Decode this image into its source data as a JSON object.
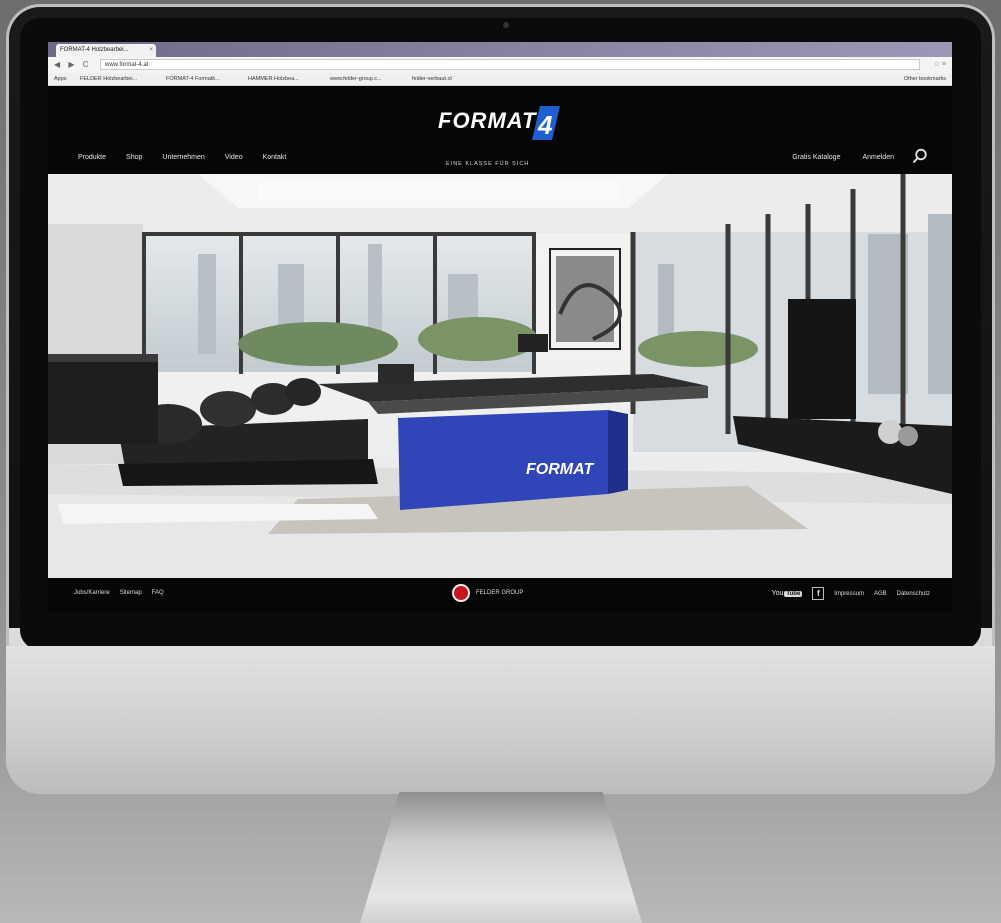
{
  "browser": {
    "tab_title": "FORMAT-4 Holzbearbei...",
    "tab_close": "×",
    "nav_buttons": "◀ ▶ C",
    "url": "www.format-4.at",
    "addr_icons": "☆ ≡",
    "bookmarks": [
      "Apps",
      "FELDER Holzbearbei...",
      "FORMAT-4 Formatk...",
      "HAMMER Holzbea...",
      "www.felder-group.c...",
      "felder-verbaut.ol"
    ],
    "other_bookmarks": "Other bookmarks"
  },
  "header": {
    "logo_text": "FORMAT",
    "logo_number": "4",
    "tagline": "EINE KLASSE FÜR SICH",
    "main_nav": [
      "Produkte",
      "Shop",
      "Unternehmen",
      "Video",
      "Kontakt"
    ],
    "right_nav": [
      "Gratis Kataloge",
      "Anmelden"
    ],
    "brand_color": "#1f5fd1"
  },
  "footer": {
    "left_links": [
      "Jobs/Karriere",
      "Sitemap",
      "FAQ"
    ],
    "felder_text": "FELDER GROUP",
    "youtube": "You",
    "youtube_tube": "Tube",
    "facebook": "f",
    "right_links": [
      "Impressum",
      "AGB",
      "Datenschutz"
    ]
  },
  "hero": {
    "machine_label": "FORMAT",
    "machine_color": "#2f45b8"
  }
}
